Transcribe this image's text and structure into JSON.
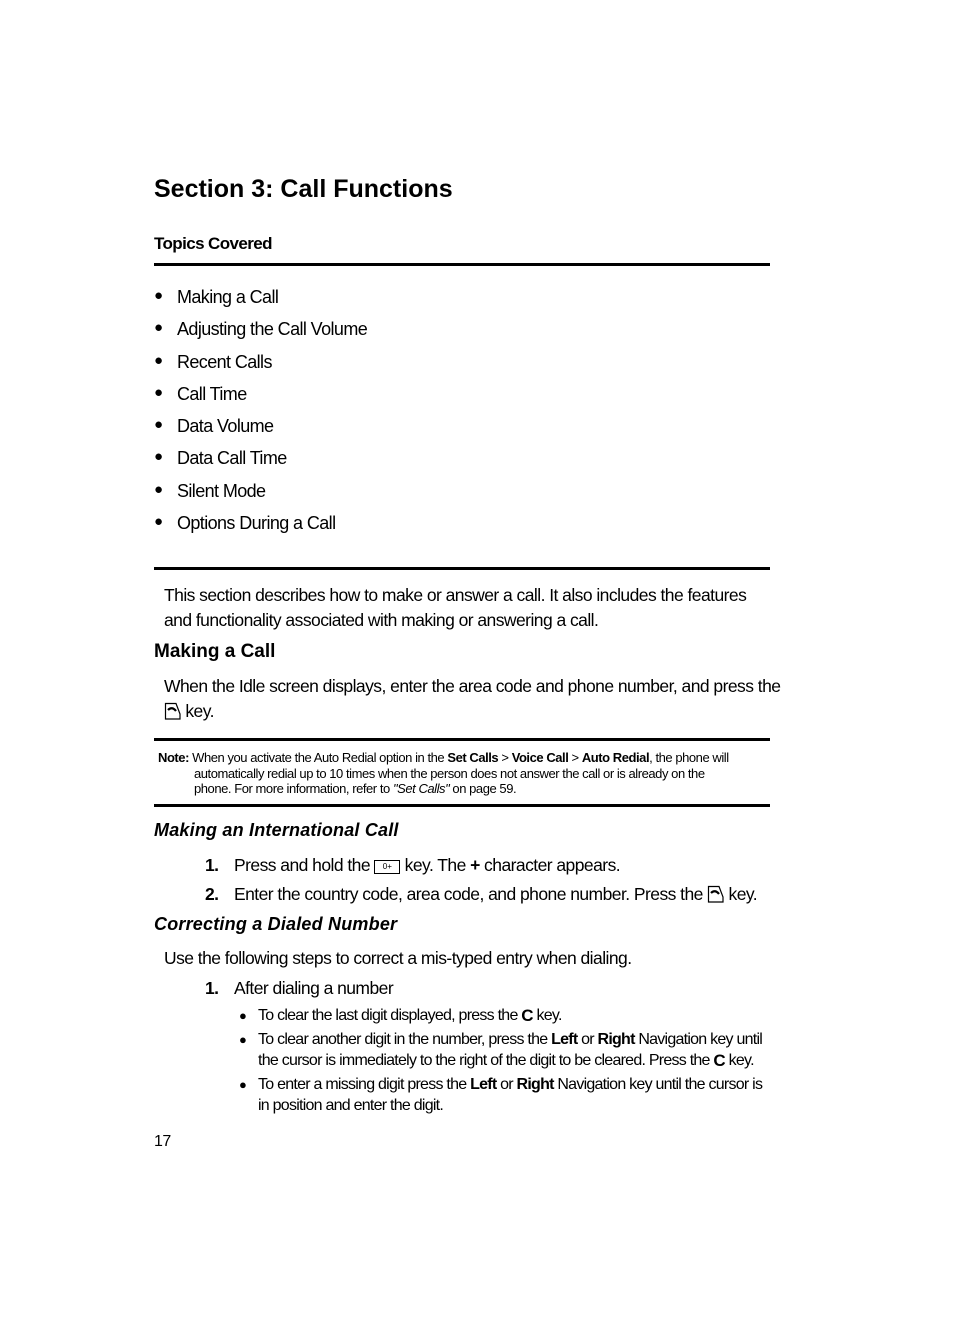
{
  "section_title": "Section 3: Call Functions",
  "topics": {
    "heading": "Topics Covered",
    "items": [
      "Making a Call",
      "Adjusting the Call Volume",
      "Recent Calls",
      "Call Time",
      "Data Volume",
      "Data Call Time",
      "Silent Mode",
      "Options During a Call"
    ]
  },
  "intro": {
    "line1": "This section describes how to make or answer a call. It also includes the features",
    "line2": "and functionality associated with making or answering a call."
  },
  "making_a_call": {
    "heading": "Making a Call",
    "line1": "When the Idle screen displays, enter the area code and phone number, and press the",
    "line2_after_icon": "key.",
    "icon": "send-key-icon"
  },
  "note": {
    "label": "Note:",
    "t1": "When you activate the Auto Redial option in the ",
    "b1": "Set Calls",
    "sep1": " > ",
    "b2": "Voice Call",
    "sep2": " > ",
    "b3": "Auto Redial",
    "t2": ", the phone will",
    "line2": "automatically redial up to 10 times when the person does not answer the call or is already on the",
    "line3_pre": "phone. For more information, refer to ",
    "line3_link": "\"Set Calls\"",
    "line3_post": "  on page 59."
  },
  "international": {
    "heading": "Making an International Call",
    "steps": [
      {
        "num": "1.",
        "pre": "Press and hold the ",
        "key_label": "0+",
        "mid": " key. The ",
        "plus": "+",
        "post": " character appears."
      },
      {
        "num": "2.",
        "pre": "Enter the country code, area code, and phone number. Press the ",
        "post": " key."
      }
    ]
  },
  "correcting": {
    "heading": "Correcting a Dialed Number",
    "intro": "Use the following steps to correct a mis-typed entry when dialing.",
    "step_num": "1.",
    "step_text": "After dialing a number",
    "c_key": "C",
    "bullets": [
      {
        "pre": "To clear the last digit displayed, press the ",
        "post": " key."
      },
      {
        "pre": "To clear another digit in the number, press the ",
        "b1": "Left",
        "mid": " or ",
        "b2": "Right",
        "post1": " Navigation key until",
        "line2_pre": "the cursor is immediately to the right of the digit to be cleared. Press the ",
        "line2_post": " key."
      },
      {
        "pre": "To enter a missing digit press the ",
        "b1": "Left",
        "mid": " or ",
        "b2": "Right",
        "post1": " Navigation key until the cursor is",
        "line2": "in position and enter the digit."
      }
    ]
  },
  "page_number": "17"
}
